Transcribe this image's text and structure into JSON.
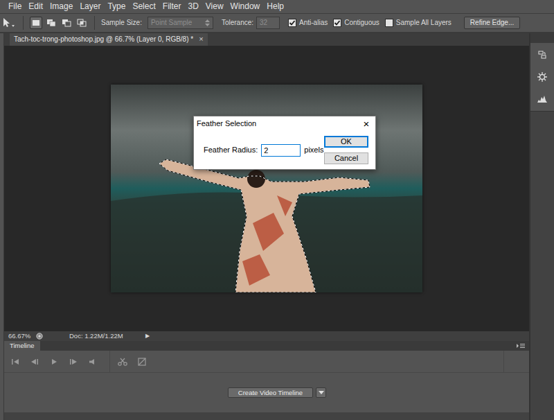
{
  "menu": [
    "File",
    "Edit",
    "Image",
    "Layer",
    "Type",
    "Select",
    "Filter",
    "3D",
    "View",
    "Window",
    "Help"
  ],
  "options_bar": {
    "selection_modes": [
      {
        "selected": true
      },
      {
        "selected": false
      },
      {
        "selected": false
      },
      {
        "selected": false
      }
    ],
    "sample_size": {
      "label": "Sample Size:",
      "value": "Point Sample",
      "disabled": true
    },
    "tolerance": {
      "label": "Tolerance:",
      "value": "32",
      "disabled": true
    },
    "checkboxes": [
      {
        "label": "Anti-alias",
        "checked": true
      },
      {
        "label": "Contiguous",
        "checked": true
      },
      {
        "label": "Sample All Layers",
        "checked": false
      }
    ],
    "refine_button": "Refine Edge..."
  },
  "document_tab": {
    "title": "Tach-toc-trong-photoshop.jpg @ 66.7% (Layer 0, RGB/8) *",
    "close": "×"
  },
  "dialog": {
    "title": "Feather Selection",
    "close": "×",
    "field_label": "Feather Radius:",
    "field_value": "2",
    "unit": "pixels",
    "buttons": [
      {
        "label": "OK",
        "selected": true
      },
      {
        "label": "Cancel",
        "selected": false
      }
    ]
  },
  "status_bar": {
    "zoom": "66.67%",
    "doc": "Doc: 1.22M/1.22M",
    "arrow": "▶"
  },
  "timeline": {
    "title": "Timeline",
    "create_button": "Create Video Timeline"
  }
}
